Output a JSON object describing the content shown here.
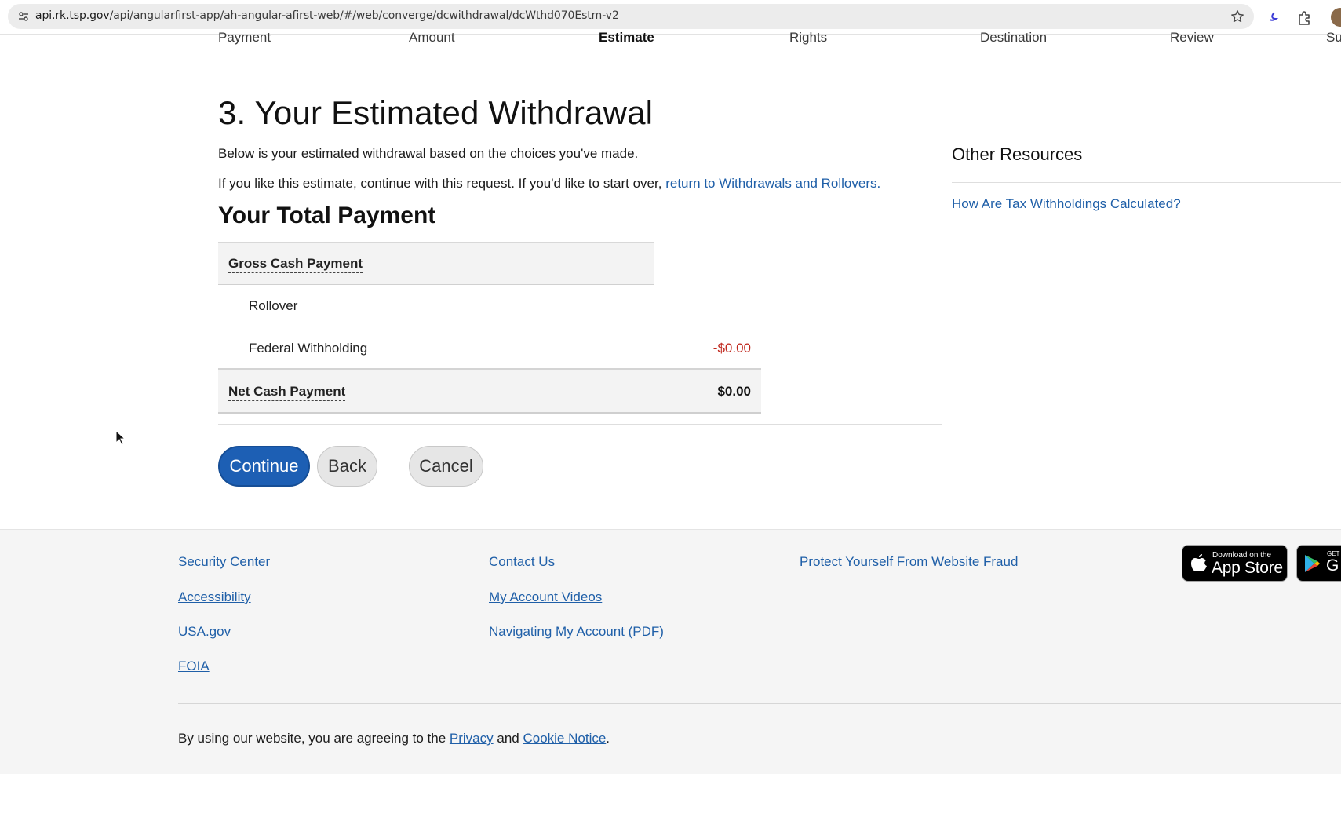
{
  "browser": {
    "url_host": "api.rk.tsp.gov",
    "url_path": "/api/angularfirst-app/ah-angular-afirst-web/#/web/converge/dcwithdrawal/dcWthd070Estm-v2"
  },
  "steps": [
    {
      "label": "Payment"
    },
    {
      "label": "Amount"
    },
    {
      "label": "Estimate",
      "active": true
    },
    {
      "label": "Rights"
    },
    {
      "label": "Destination"
    },
    {
      "label": "Review"
    },
    {
      "label": "Su"
    }
  ],
  "main": {
    "title": "3. Your Estimated Withdrawal",
    "intro": "Below is your estimated withdrawal based on the choices you've made.",
    "intro2_text": "If you like this estimate, continue with this request. If you'd like to start over,",
    "intro2_link": "return to Withdrawals and Rollovers.",
    "section_title": "Your Total Payment",
    "gross_label": "Gross Cash Payment",
    "rows": [
      {
        "label": "Rollover",
        "amount": ""
      },
      {
        "label": "Federal Withholding",
        "amount": "-$0.00"
      }
    ],
    "net_label": "Net Cash Payment",
    "net_amount": "$0.00",
    "buttons": {
      "continue": "Continue",
      "back": "Back",
      "cancel": "Cancel"
    }
  },
  "sidebar": {
    "title": "Other Resources",
    "link": "How Are Tax Withholdings Calculated?"
  },
  "footer": {
    "col1": [
      "Security Center",
      "Accessibility",
      "USA.gov",
      "FOIA"
    ],
    "col2": [
      "Contact Us",
      "My Account Videos",
      "Navigating My Account (PDF)"
    ],
    "col3": [
      "Protect Yourself From Website Fraud"
    ],
    "app_store_small": "Download on the",
    "app_store_big": "App Store",
    "play_store_small": "GET IT ON",
    "play_store_big": "G",
    "legal_prefix": "By using our website, you are agreeing to the",
    "legal_privacy": "Privacy",
    "legal_and": "and",
    "legal_cookie": "Cookie Notice",
    "legal_suffix": "."
  },
  "colors": {
    "link": "#1f5fa8",
    "primary_button": "#1d5fb4",
    "negative_amount": "#c0281e"
  }
}
